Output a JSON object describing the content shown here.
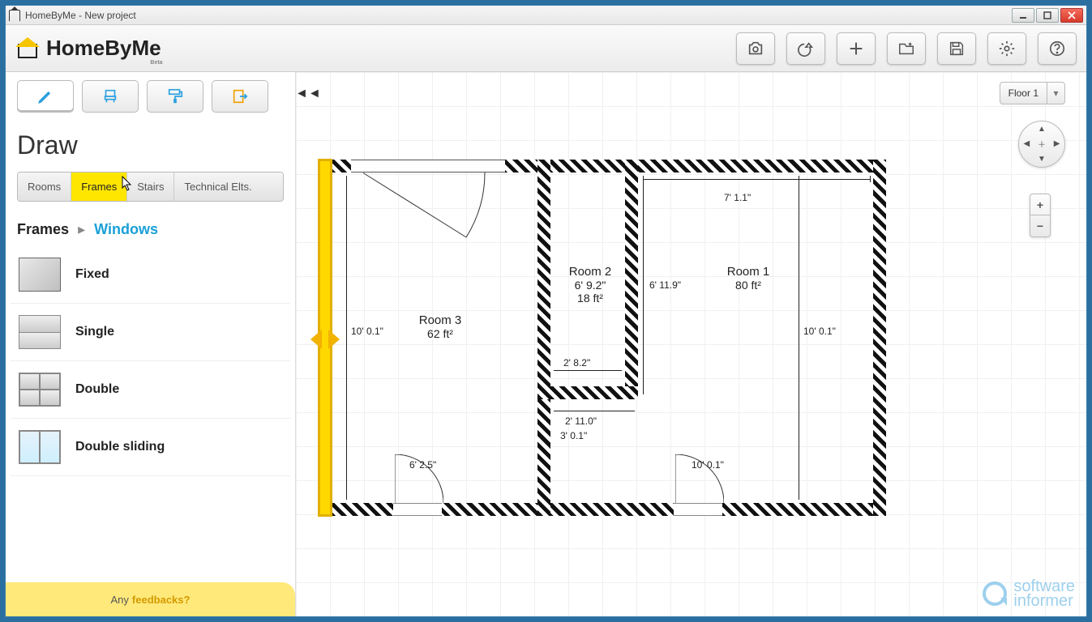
{
  "window": {
    "title": "HomeByMe - New project"
  },
  "brand": {
    "name": "HomeByMe",
    "beta": "Beta"
  },
  "header_buttons": {
    "camera": "camera",
    "undo": "undo",
    "add": "add",
    "saveas": "save-as",
    "save": "save",
    "settings": "settings",
    "help": "help"
  },
  "sidebar": {
    "section_title": "Draw",
    "mode_tabs": [
      "draw",
      "furnish",
      "decorate",
      "export"
    ],
    "sub_tabs": [
      "Rooms",
      "Frames",
      "Stairs",
      "Technical Elts."
    ],
    "active_sub_tab": "Frames",
    "breadcrumb_root": "Frames",
    "breadcrumb_leaf": "Windows",
    "items": [
      {
        "label": "Fixed",
        "kind": "fixed"
      },
      {
        "label": "Single",
        "kind": "single"
      },
      {
        "label": "Double",
        "kind": "double"
      },
      {
        "label": "Double sliding",
        "kind": "dsliding"
      }
    ],
    "feedback_prefix": "Any",
    "feedback_link": "feedbacks?"
  },
  "canvas": {
    "floor_label": "Floor 1",
    "rooms": {
      "r1": {
        "name": "Room 1",
        "area": "80 ft²"
      },
      "r2": {
        "name": "Room 2",
        "dim": "6' 9.2\"",
        "area": "18 ft²"
      },
      "r3": {
        "name": "Room 3",
        "area": "62 ft²"
      }
    },
    "dims": {
      "r1_top": "7' 1.1\"",
      "r1_left": "6' 11.9\"",
      "r1_right": "10' 0.1\"",
      "r3_left": "10' 0.1\"",
      "r2_bottom": "2' 8.2\"",
      "hall_w": "2' 11.0\"",
      "hall_w2": "3' 0.1\"",
      "door_l": "6' 2.5\"",
      "door_r": "10' 0.1\""
    }
  },
  "watermark": {
    "line1": "software",
    "line2": "informer"
  }
}
